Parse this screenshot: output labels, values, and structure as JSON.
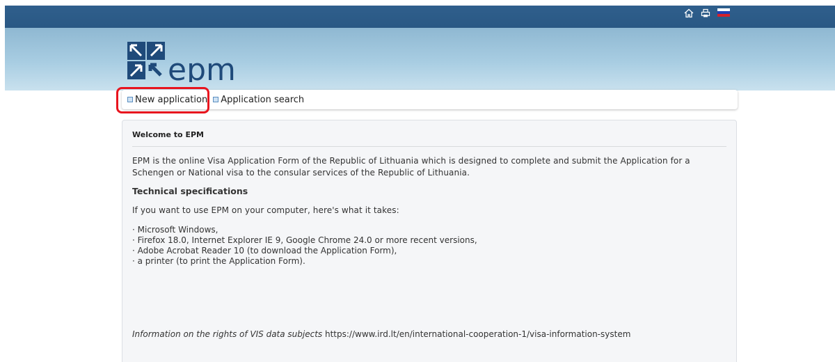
{
  "topbar": {
    "icons": [
      "home-icon",
      "print-icon",
      "flag-icon"
    ],
    "flag_colors": [
      "#ffffff",
      "#1f3fb5",
      "#d3202a"
    ]
  },
  "logo": {
    "text": "epm",
    "brand_color": "#1f4a7a"
  },
  "nav": {
    "items": [
      {
        "label": "New application",
        "icon": "document-icon"
      },
      {
        "label": "Application search",
        "icon": "document-icon"
      }
    ],
    "highlight_color": "#e8141e"
  },
  "panel": {
    "title": "Welcome to EPM",
    "intro": "EPM is the online Visa Application Form of the Republic of Lithuania which is designed to complete and submit the Application for a Schengen or National visa to the consular services of the Republic of Lithuania.",
    "tech_heading": "Technical specifications",
    "tech_intro": "If you want to use EPM on your computer, here's what it takes:",
    "requirements": [
      "Microsoft Windows,",
      "Firefox 18.0, Internet Explorer IE 9, Google Chrome 24.0 or more recent versions,",
      "Adobe Acrobat Reader 10 (to download the Application Form),",
      "a printer (to print the Application Form)."
    ],
    "vis_label": "Information on the rights of VIS data subjects",
    "vis_url": "https://www.ird.lt/en/international-cooperation-1/visa-information-system"
  }
}
